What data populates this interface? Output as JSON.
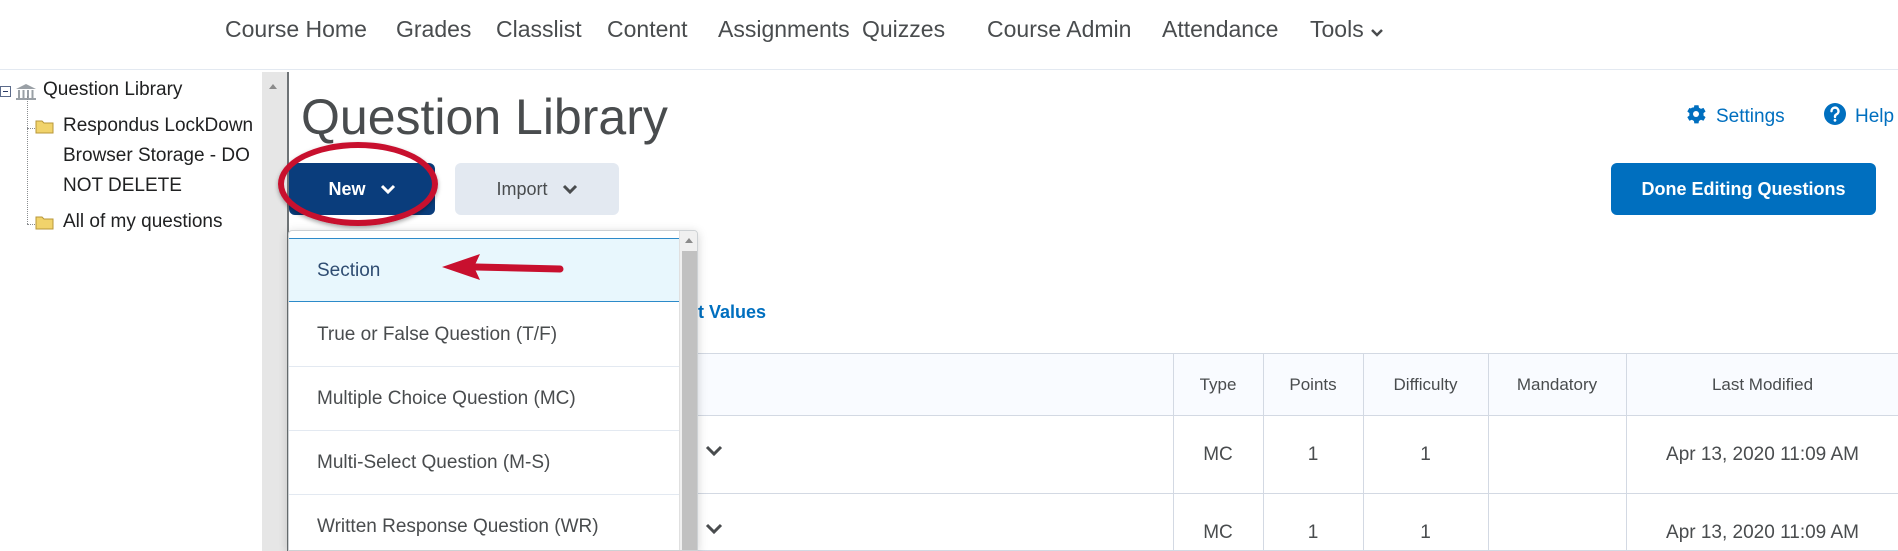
{
  "nav": {
    "items": [
      "Course Home",
      "Grades",
      "Classlist",
      "Content",
      "Assignments",
      "Quizzes",
      "Course Admin",
      "Attendance",
      "Tools"
    ]
  },
  "tree": {
    "root": "Question Library",
    "folder1": "Respondus LockDown Browser Storage - DO NOT DELETE",
    "folder2": "All of my questions"
  },
  "page": {
    "title": "Question Library",
    "settings_label": "Settings",
    "help_label": "Help"
  },
  "toolbar": {
    "new_label": "New",
    "import_label": "Import",
    "done_label": "Done Editing Questions"
  },
  "edit_values_label": "dit Values",
  "new_menu": {
    "items": [
      "Section",
      "True or False Question (T/F)",
      "Multiple Choice Question (MC)",
      "Multi-Select Question (M-S)",
      "Written Response Question (WR)"
    ]
  },
  "table": {
    "headers": {
      "type": "Type",
      "points": "Points",
      "difficulty": "Difficulty",
      "mandatory": "Mandatory",
      "last_modified": "Last Modified"
    },
    "rows": [
      {
        "type": "MC",
        "points": "1",
        "difficulty": "1",
        "mandatory": "",
        "last_modified": "Apr 13, 2020 11:09 AM"
      },
      {
        "type": "MC",
        "points": "1",
        "difficulty": "1",
        "mandatory": "",
        "last_modified": "Apr 13, 2020 11:09 AM"
      }
    ]
  },
  "colors": {
    "primary_dark": "#0a3d7c",
    "primary": "#006fbf",
    "annotation_red": "#c8102e"
  },
  "icons": [
    "chevron-down-icon",
    "gear-icon",
    "help-circle-icon",
    "folder-icon",
    "library-icon",
    "expander-minus-icon",
    "red-arrow-annotation"
  ]
}
